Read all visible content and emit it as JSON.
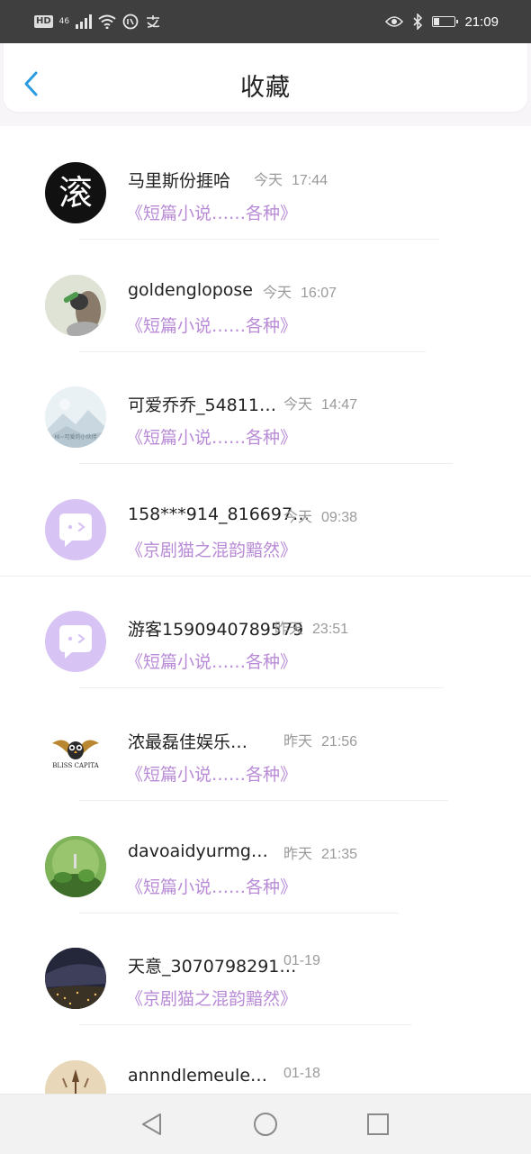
{
  "status_bar": {
    "hd": "HD",
    "network": "46",
    "time": "21:09",
    "battery_level": 0.3,
    "icons": [
      "signal-icon",
      "wifi-icon",
      "data-saver-icon",
      "alipay-icon",
      "eye-icon",
      "bluetooth-icon",
      "battery-icon"
    ]
  },
  "header": {
    "title": "收藏",
    "back_icon": "chevron-left-icon",
    "accent": "#2a9be0"
  },
  "items": [
    {
      "name": "马里斯份捱哈",
      "day": "今天",
      "time": "17:44",
      "book": "《短篇小说……各种》"
    },
    {
      "name": "goldenglopose",
      "day": "今天",
      "time": "16:07",
      "book": "《短篇小说……各种》"
    },
    {
      "name": "可爱乔乔_54811…",
      "day": "今天",
      "time": "14:47",
      "book": "《短篇小说……各种》"
    },
    {
      "name": "158***914_816697…",
      "day": "今天",
      "time": "09:38",
      "book": "《京剧猫之混韵黯然》"
    },
    {
      "name": "游客1590940789579",
      "day": "昨天",
      "time": "23:51",
      "book": "《短篇小说……各种》"
    },
    {
      "name": "浓最磊佳娱乐…",
      "day": "昨天",
      "time": "21:56",
      "book": "《短篇小说……各种》"
    },
    {
      "name": "davoaidyurmg…",
      "day": "昨天",
      "time": "21:35",
      "book": "《短篇小说……各种》"
    },
    {
      "name": "天意_3070798291…",
      "day": "",
      "time": "01-19",
      "book": "《京剧猫之混韵黯然》"
    },
    {
      "name": "annndlemeule…",
      "day": "",
      "time": "01-18",
      "book": ""
    }
  ],
  "avatar_text": {
    "a1": "滚",
    "a3": "Hi~可爱的小伙伴",
    "a6": "BLISS CAPITA"
  },
  "colors": {
    "book_title": "#b98bd6",
    "avatar_purple": "#d8c4f4",
    "status_bar": "#3f3f3f"
  },
  "nav_bar": {
    "icons": [
      "back-triangle-icon",
      "home-circle-icon",
      "recents-square-icon"
    ]
  }
}
